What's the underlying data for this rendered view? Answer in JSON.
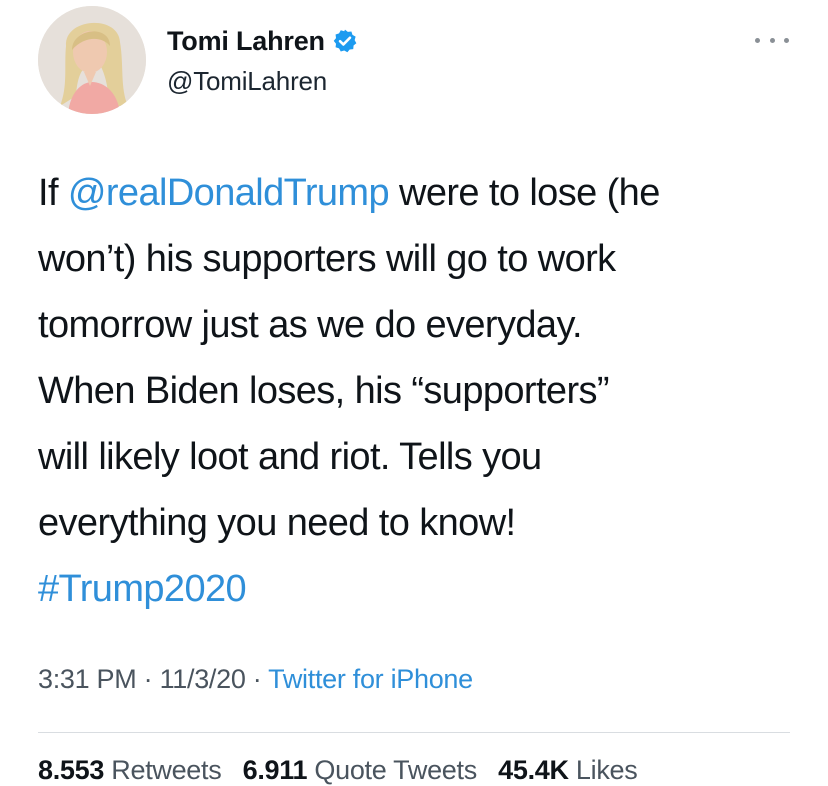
{
  "author": {
    "display_name": "Tomi Lahren",
    "handle": "@TomiLahren",
    "avatar_icon": "profile-photo",
    "verified_icon": "verified-badge-icon",
    "verified_color": "#1d9bf0"
  },
  "more_icon": "more-options-icon",
  "tweet": {
    "lines": [
      {
        "pre": "If ",
        "mention": "@realDonaldTrump",
        "post": " were to lose (he"
      },
      "won’t) his supporters will go to work",
      "tomorrow just as we do everyday.",
      "When Biden loses, his “supporters”",
      "will likely loot and riot. Tells you",
      "everything you need to know!"
    ],
    "hashtag": "#Trump2020"
  },
  "meta": {
    "time": "3:31 PM",
    "sep": " · ",
    "date": "11/3/20",
    "source": "Twitter for iPhone"
  },
  "stats": {
    "retweets_count": "8.553",
    "retweets_label": "Retweets",
    "quotes_count": "6.911",
    "quotes_label": "Quote Tweets",
    "likes_count": "45.4K",
    "likes_label": "Likes"
  },
  "colors": {
    "link": "#2f8fd9",
    "text": "#0f1419",
    "secondary": "#4a545e"
  }
}
